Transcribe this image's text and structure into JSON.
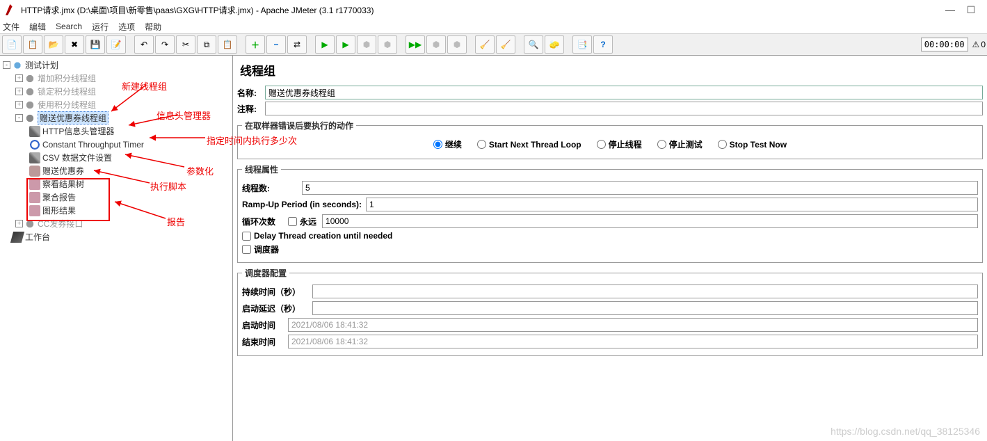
{
  "window": {
    "title": "HTTP请求.jmx (D:\\桌面\\项目\\新零售\\paas\\GXG\\HTTP请求.jmx) - Apache JMeter (3.1 r1770033)",
    "timer": "00:00:00",
    "warn_count": "0"
  },
  "menu": {
    "items": [
      "文件",
      "编辑",
      "Search",
      "运行",
      "选项",
      "帮助"
    ]
  },
  "tree": {
    "root": "测试计划",
    "g1": "增加积分线程组",
    "g2": "锁定积分线程组",
    "g3": "使用积分线程组",
    "sel": "赠送优惠券线程组",
    "c1": "HTTP信息头管理器",
    "c2": "Constant Throughput Timer",
    "c3": "CSV 数据文件设置",
    "c4": "赠送优惠券",
    "c5": "察看结果树",
    "c6": "聚合报告",
    "c7": "图形结果",
    "g5": "CC发券接口",
    "wb": "工作台"
  },
  "anno": {
    "a1": "新建线程组",
    "a2": "信息头管理器",
    "a3": "指定时间内执行多少次",
    "a4": "参数化",
    "a5": "执行脚本",
    "a6": "报告"
  },
  "detail": {
    "title": "线程组",
    "name_label": "名称:",
    "name_value": "赠送优惠券线程组",
    "comment_label": "注释:",
    "comment_value": "",
    "error_legend": "在取样器错误后要执行的动作",
    "radios": {
      "r1": "继续",
      "r2": "Start Next Thread Loop",
      "r3": "停止线程",
      "r4": "停止测试",
      "r5": "Stop Test Now"
    },
    "props_legend": "线程属性",
    "threads_label": "线程数:",
    "threads_value": "5",
    "ramp_label": "Ramp-Up Period (in seconds):",
    "ramp_value": "1",
    "loop_label": "循环次数",
    "forever_label": "永远",
    "loop_value": "10000",
    "delay_label": "Delay Thread creation until needed",
    "sched_label": "调度器",
    "sched_legend": "调度器配置",
    "duration_label": "持续时间（秒）",
    "duration_value": "",
    "delaystart_label": "启动延迟（秒）",
    "delaystart_value": "",
    "starttime_label": "启动时间",
    "starttime_value": "2021/08/06 18:41:32",
    "endtime_label": "结束时间",
    "endtime_value": "2021/08/06 18:41:32"
  },
  "watermark": "https://blog.csdn.net/qq_38125346"
}
